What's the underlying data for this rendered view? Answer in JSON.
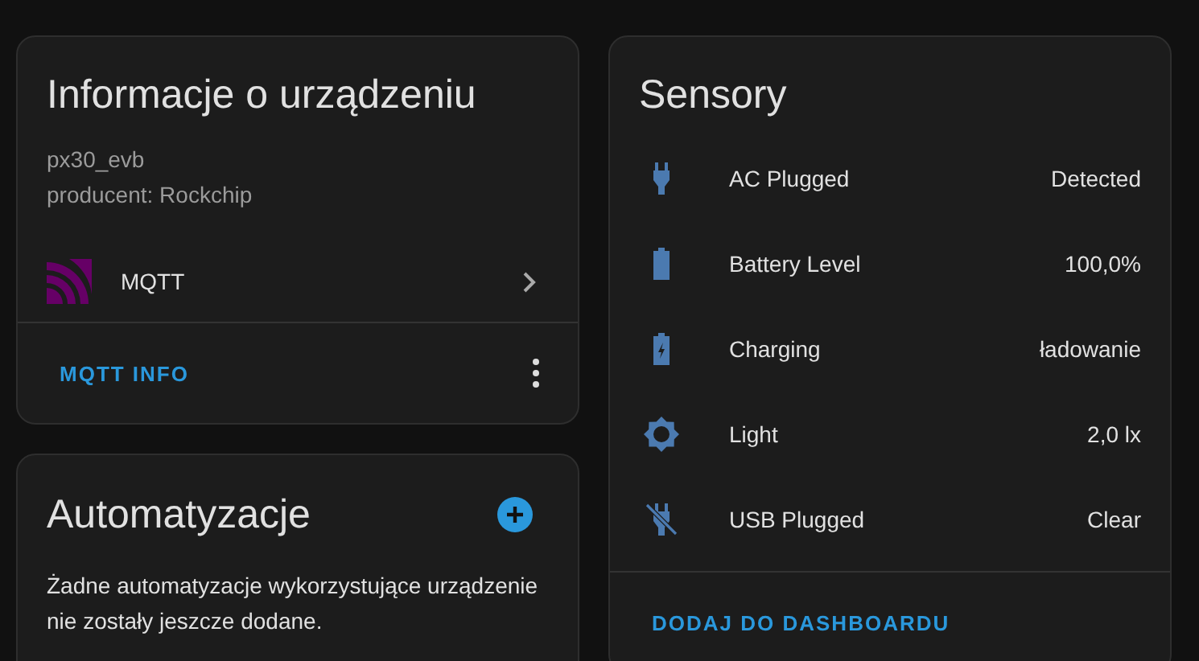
{
  "device_info": {
    "title": "Informacje o urządzeniu",
    "model": "px30_evb",
    "manufacturer": "producent: Rockchip",
    "integration": {
      "name": "MQTT"
    },
    "action": "MQTT INFO"
  },
  "automations": {
    "title": "Automatyzacje",
    "message": "Żadne automatyzacje wykorzystujące urządzenie nie zostały jeszcze dodane."
  },
  "sensors": {
    "title": "Sensory",
    "items": [
      {
        "kind": "plug",
        "name": "AC Plugged",
        "value": "Detected"
      },
      {
        "kind": "battery",
        "name": "Battery Level",
        "value": "100,0%"
      },
      {
        "kind": "charging",
        "name": "Charging",
        "value": "ładowanie"
      },
      {
        "kind": "light",
        "name": "Light",
        "value": "2,0 lx"
      },
      {
        "kind": "plug-off",
        "name": "USB Plugged",
        "value": "Clear"
      }
    ],
    "action": "DODAJ DO DASHBOARDU"
  }
}
